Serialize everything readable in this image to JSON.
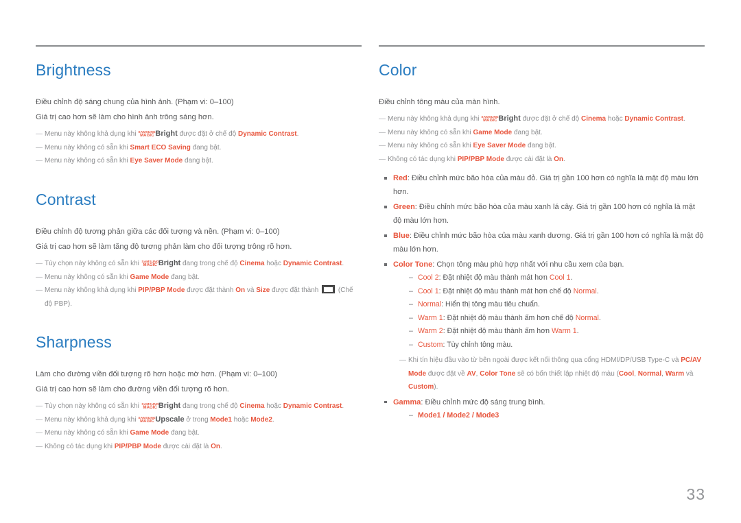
{
  "page": {
    "number": "33",
    "accent_heading_color": "#2a7cc0",
    "accent_highlight_color": "#e8573f",
    "body_text_color": "#58595b",
    "note_text_color": "#8c8d8f",
    "logo_samsung": "SAMSUNG",
    "logo_magic": "MAGIC",
    "dash_glyph": "—",
    "sub_dash_glyph": "–",
    "pbp_icon_name": "pbp-split-screen-icon"
  },
  "left_column": {
    "sections": [
      {
        "title": "Brightness",
        "paragraphs": [
          "Điều chỉnh độ sáng chung của hình ảnh. (Phạm vi: 0–100)",
          "Giá trị cao hơn sẽ làm cho hình ảnh trông sáng hơn."
        ],
        "notes": [
          {
            "pre": "Menu này không khả dụng khi ",
            "logo": true,
            "bright": "Bright",
            "mid": " được đặt ở chế độ ",
            "hl": "Dynamic Contrast",
            "post": "."
          },
          {
            "pre": "Menu này không có sẵn khi ",
            "hl": "Smart ECO Saving",
            "post": " đang bật."
          },
          {
            "pre": "Menu này không có sẵn khi ",
            "hl": "Eye Saver Mode",
            "post": " đang bật."
          }
        ]
      },
      {
        "title": "Contrast",
        "paragraphs": [
          "Điều chỉnh độ tương phản giữa các đối tượng và nền. (Phạm vi: 0–100)",
          "Giá trị cao hơn sẽ làm tăng độ tương phản làm cho đối tượng trông rõ hơn."
        ],
        "notes": [
          {
            "pre": "Tùy chọn này không có sẵn khi ",
            "logo": true,
            "bright": "Bright",
            "mid": " đang trong chế độ ",
            "hl": "Cinema",
            "mid2": " hoặc ",
            "hl2": "Dynamic Contrast",
            "post": "."
          },
          {
            "pre": "Menu này không có sẵn khi ",
            "hl": "Game Mode",
            "post": " đang bật."
          },
          {
            "pre": "Menu này không khả dụng khi ",
            "hl": "PIP/PBP Mode",
            "mid": " được đặt thành ",
            "hl2": "On",
            "mid2": " và ",
            "hl3": "Size",
            "mid3": " được đặt thành ",
            "icon": true,
            "post": " (Chế độ PBP)."
          }
        ]
      },
      {
        "title": "Sharpness",
        "paragraphs": [
          "Làm cho đường viền đối tượng rõ hơn hoặc mờ hơn. (Phạm vi: 0–100)",
          "Giá trị cao hơn sẽ làm cho đường viền đối tượng rõ hơn."
        ],
        "notes": [
          {
            "pre": "Tùy chọn này không có sẵn khi ",
            "logo": true,
            "bright": "Bright",
            "mid": " đang trong chế độ ",
            "hl": "Cinema",
            "mid2": " hoặc ",
            "hl2": "Dynamic Contrast",
            "post": "."
          },
          {
            "pre": "Menu này không khả dụng khi ",
            "logo": true,
            "bright": "Upscale",
            "mid": " ở trong ",
            "hl": "Mode1",
            "mid2": " hoặc ",
            "hl2": "Mode2",
            "post": "."
          },
          {
            "pre": "Menu này không có sẵn khi ",
            "hl": "Game Mode",
            "post": " đang bật."
          },
          {
            "pre": "Không có tác dụng khi ",
            "hl": "PIP/PBP Mode",
            "mid": " được cài đặt là ",
            "hl2": "On",
            "post": "."
          }
        ]
      }
    ]
  },
  "right_column": {
    "section": {
      "title": "Color",
      "paragraphs": [
        "Điều chỉnh tông màu của màn hình."
      ],
      "notes": [
        {
          "pre": "Menu này không khả dụng khi ",
          "logo": true,
          "bright": "Bright",
          "mid": " được đặt ở chế độ ",
          "hl": "Cinema",
          "mid2": " hoặc ",
          "hl2": "Dynamic Contrast",
          "post": "."
        },
        {
          "pre": "Menu này không có sẵn khi ",
          "hl": "Game Mode",
          "post": " đang bật."
        },
        {
          "pre": "Menu này không có sẵn khi ",
          "hl": "Eye Saver Mode",
          "post": " đang bật."
        },
        {
          "pre": "Không có tác dụng khi ",
          "hl": "PIP/PBP Mode",
          "mid": " được cài đặt là ",
          "hl2": "On",
          "post": "."
        }
      ],
      "bullets": [
        {
          "term": "Red",
          "text": ": Điều chỉnh mức bão hòa của màu đỏ. Giá trị gần 100 hơn có nghĩa là mật độ màu lớn hơn."
        },
        {
          "term": "Green",
          "text": ": Điều chỉnh mức bão hòa của màu xanh lá cây. Giá trị gần 100 hơn có nghĩa là mật độ màu lớn hơn."
        },
        {
          "term": "Blue",
          "text": ": Điều chỉnh mức bão hòa của màu xanh dương. Giá trị gần 100 hơn có nghĩa là mật độ màu lớn hơn."
        },
        {
          "term": "Color Tone",
          "text": ": Chọn tông màu phù hợp nhất với nhu cầu xem của bạn."
        }
      ],
      "color_tone_options": [
        {
          "term": "Cool 2",
          "pre": ": Đặt nhiệt độ màu thành mát hơn ",
          "ref": "Cool 1",
          "post": "."
        },
        {
          "term": "Cool 1",
          "pre": ": Đặt nhiệt độ màu thành mát hơn chế độ ",
          "ref": "Normal",
          "post": "."
        },
        {
          "term": "Normal",
          "pre": ": Hiển thị tông màu tiêu chuẩn.",
          "ref": "",
          "post": ""
        },
        {
          "term": "Warm 1",
          "pre": ": Đặt nhiệt độ màu thành ấm hơn chế độ ",
          "ref": "Normal",
          "post": "."
        },
        {
          "term": "Warm 2",
          "pre": ": Đặt nhiệt độ màu thành ấm hơn ",
          "ref": "Warm 1",
          "post": "."
        },
        {
          "term": "Custom",
          "pre": ": Tùy chỉnh tông màu.",
          "ref": "",
          "post": ""
        }
      ],
      "color_tone_note": {
        "pre": "Khi tín hiệu đầu vào từ bên ngoài được kết nối thông qua cổng HDMI/DP/USB Type-C và ",
        "hl1": "PC/AV Mode",
        "mid1": " được đặt về ",
        "hl2": "AV",
        "mid2": ", ",
        "hl3": "Color Tone",
        "mid3": " sẽ có bốn thiết lập nhiệt độ màu (",
        "hl4": "Cool",
        "mid4": ", ",
        "hl5": "Normal",
        "mid5": ", ",
        "hl6": "Warm",
        "mid6": " và ",
        "hl7": "Custom",
        "post": ")."
      },
      "gamma_bullet": {
        "term": "Gamma",
        "text": ": Điều chỉnh mức độ sáng trung bình."
      },
      "gamma_modes": "Mode1 / Mode2 / Mode3"
    }
  }
}
